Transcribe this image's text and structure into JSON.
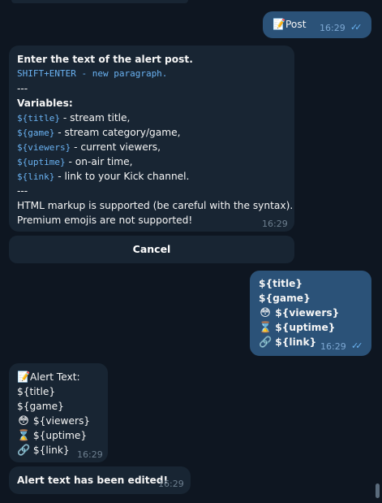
{
  "messages": {
    "post_out": {
      "emoji": "📝",
      "text": "Post",
      "time": "16:29"
    },
    "prompt": {
      "heading": "Enter the text of the alert post.",
      "shift_hint": "SHIFT+ENTER - new paragraph.",
      "divider1": "---",
      "variables_label": "Variables:",
      "vars": [
        {
          "code": "${title}",
          "desc": " - stream title,"
        },
        {
          "code": "${game}",
          "desc": " - stream category/game,"
        },
        {
          "code": "${viewers}",
          "desc": " - current viewers,"
        },
        {
          "code": "${uptime}",
          "desc": " - on-air time,"
        },
        {
          "code": "${link}",
          "desc": " - link to your Kick channel."
        }
      ],
      "divider2": "---",
      "note1": "HTML markup is supported (be careful with the syntax).",
      "note2": "Premium emojis are not supported!",
      "time": "16:29"
    },
    "cancel_button": "Cancel",
    "template_out": {
      "lines": [
        {
          "emoji": "",
          "text": "${title}"
        },
        {
          "emoji": "",
          "text": "${game}"
        },
        {
          "emoji": "😳",
          "text": "${viewers}"
        },
        {
          "emoji": "⌛",
          "text": "${uptime}"
        },
        {
          "emoji": "🔗",
          "text": "${link}"
        }
      ],
      "time": "16:29"
    },
    "alert_in": {
      "header_emoji": "📝",
      "header": "Alert Text:",
      "lines": [
        {
          "emoji": "",
          "text": "${title}"
        },
        {
          "emoji": "",
          "text": "${game}"
        },
        {
          "emoji": "😳",
          "text": "${viewers}"
        },
        {
          "emoji": "⌛",
          "text": "${uptime}"
        },
        {
          "emoji": "🔗",
          "text": "${link}"
        }
      ],
      "time": "16:29"
    },
    "edited": {
      "text": "Alert text has been edited!",
      "time": "16:29"
    }
  }
}
